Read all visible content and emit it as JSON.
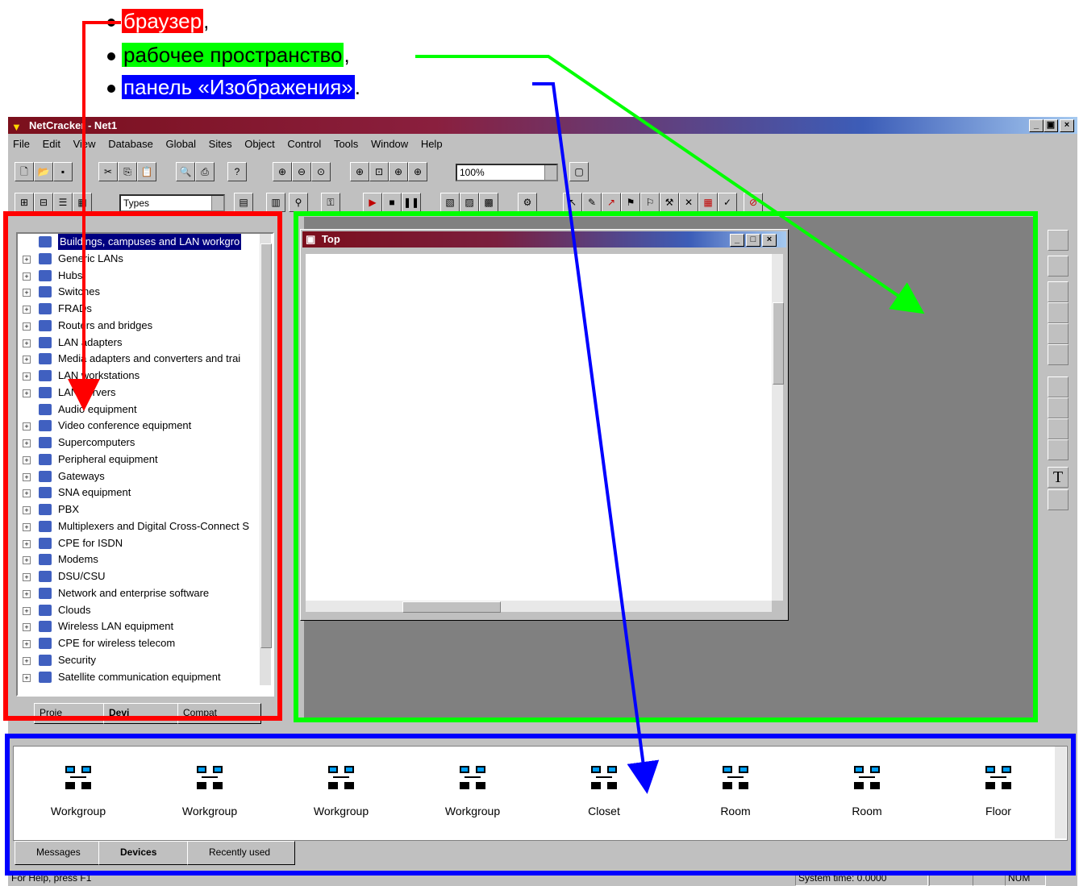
{
  "bullets": [
    {
      "text": "браузер",
      "suffix": ",",
      "color": "#ff0000",
      "text_color": "#ffffff"
    },
    {
      "text": "рабочее пространство",
      "suffix": ",",
      "color": "#00ff00",
      "text_color": "#000000"
    },
    {
      "text": "панель «Изображения»",
      "suffix": ".",
      "color": "#0000ff",
      "text_color": "#ffffff"
    }
  ],
  "window": {
    "title": "NetCracker - Net1",
    "controls": {
      "minimize": "_",
      "maximize": "▣",
      "close": "×"
    }
  },
  "menu": [
    "File",
    "Edit",
    "View",
    "Database",
    "Global",
    "Sites",
    "Object",
    "Control",
    "Tools",
    "Window",
    "Help"
  ],
  "toolbar": {
    "zoom_value": "100%",
    "types_combo": "Types"
  },
  "browser": {
    "items": [
      {
        "label": "Buildings, campuses and LAN workgro",
        "selected": true,
        "expandable": false
      },
      {
        "label": "Generic LANs",
        "expandable": true
      },
      {
        "label": "Hubs",
        "expandable": true
      },
      {
        "label": "Switches",
        "expandable": true
      },
      {
        "label": "FRADs",
        "expandable": true
      },
      {
        "label": "Routers and bridges",
        "expandable": true
      },
      {
        "label": "LAN adapters",
        "expandable": true
      },
      {
        "label": "Media adapters and converters and trai",
        "expandable": true
      },
      {
        "label": "LAN workstations",
        "expandable": true
      },
      {
        "label": "LAN servers",
        "expandable": true
      },
      {
        "label": "Audio equipment",
        "expandable": false
      },
      {
        "label": "Video conference equipment",
        "expandable": true
      },
      {
        "label": "Supercomputers",
        "expandable": true
      },
      {
        "label": "Peripheral equipment",
        "expandable": true
      },
      {
        "label": "Gateways",
        "expandable": true
      },
      {
        "label": "SNA equipment",
        "expandable": true
      },
      {
        "label": "PBX",
        "expandable": true
      },
      {
        "label": "Multiplexers and Digital Cross-Connect S",
        "expandable": true
      },
      {
        "label": "CPE for ISDN",
        "expandable": true
      },
      {
        "label": "Modems",
        "expandable": true
      },
      {
        "label": "DSU/CSU",
        "expandable": true
      },
      {
        "label": "Network and enterprise software",
        "expandable": true
      },
      {
        "label": "Clouds",
        "expandable": true
      },
      {
        "label": "Wireless LAN equipment",
        "expandable": true
      },
      {
        "label": "CPE for wireless telecom",
        "expandable": true
      },
      {
        "label": "Security",
        "expandable": true
      },
      {
        "label": "Satellite communication equipment",
        "expandable": true
      }
    ],
    "tabs": [
      "Proje",
      "Devi",
      "Compat"
    ]
  },
  "child_window": {
    "title": "Top"
  },
  "images_panel": {
    "items": [
      {
        "label": "Workgroup",
        "icon": "workgroup-bus-icon"
      },
      {
        "label": "Workgroup",
        "icon": "workgroup-tree-icon"
      },
      {
        "label": "Workgroup",
        "icon": "workgroup-ring-icon"
      },
      {
        "label": "Workgroup",
        "icon": "workgroup-star-icon"
      },
      {
        "label": "Closet",
        "icon": "closet-icon"
      },
      {
        "label": "Room",
        "icon": "room-icon"
      },
      {
        "label": "Room",
        "icon": "room-icon"
      },
      {
        "label": "Floor",
        "icon": "floor-icon"
      }
    ],
    "tabs": [
      "Messages",
      "Devices",
      "Recently used"
    ]
  },
  "status": {
    "help": "For Help, press F1",
    "system_time": "System time: 0.0000",
    "num": "NUM"
  },
  "annotation_colors": {
    "browser": "#ff0000",
    "workspace": "#00ff00",
    "images": "#0000ff"
  }
}
